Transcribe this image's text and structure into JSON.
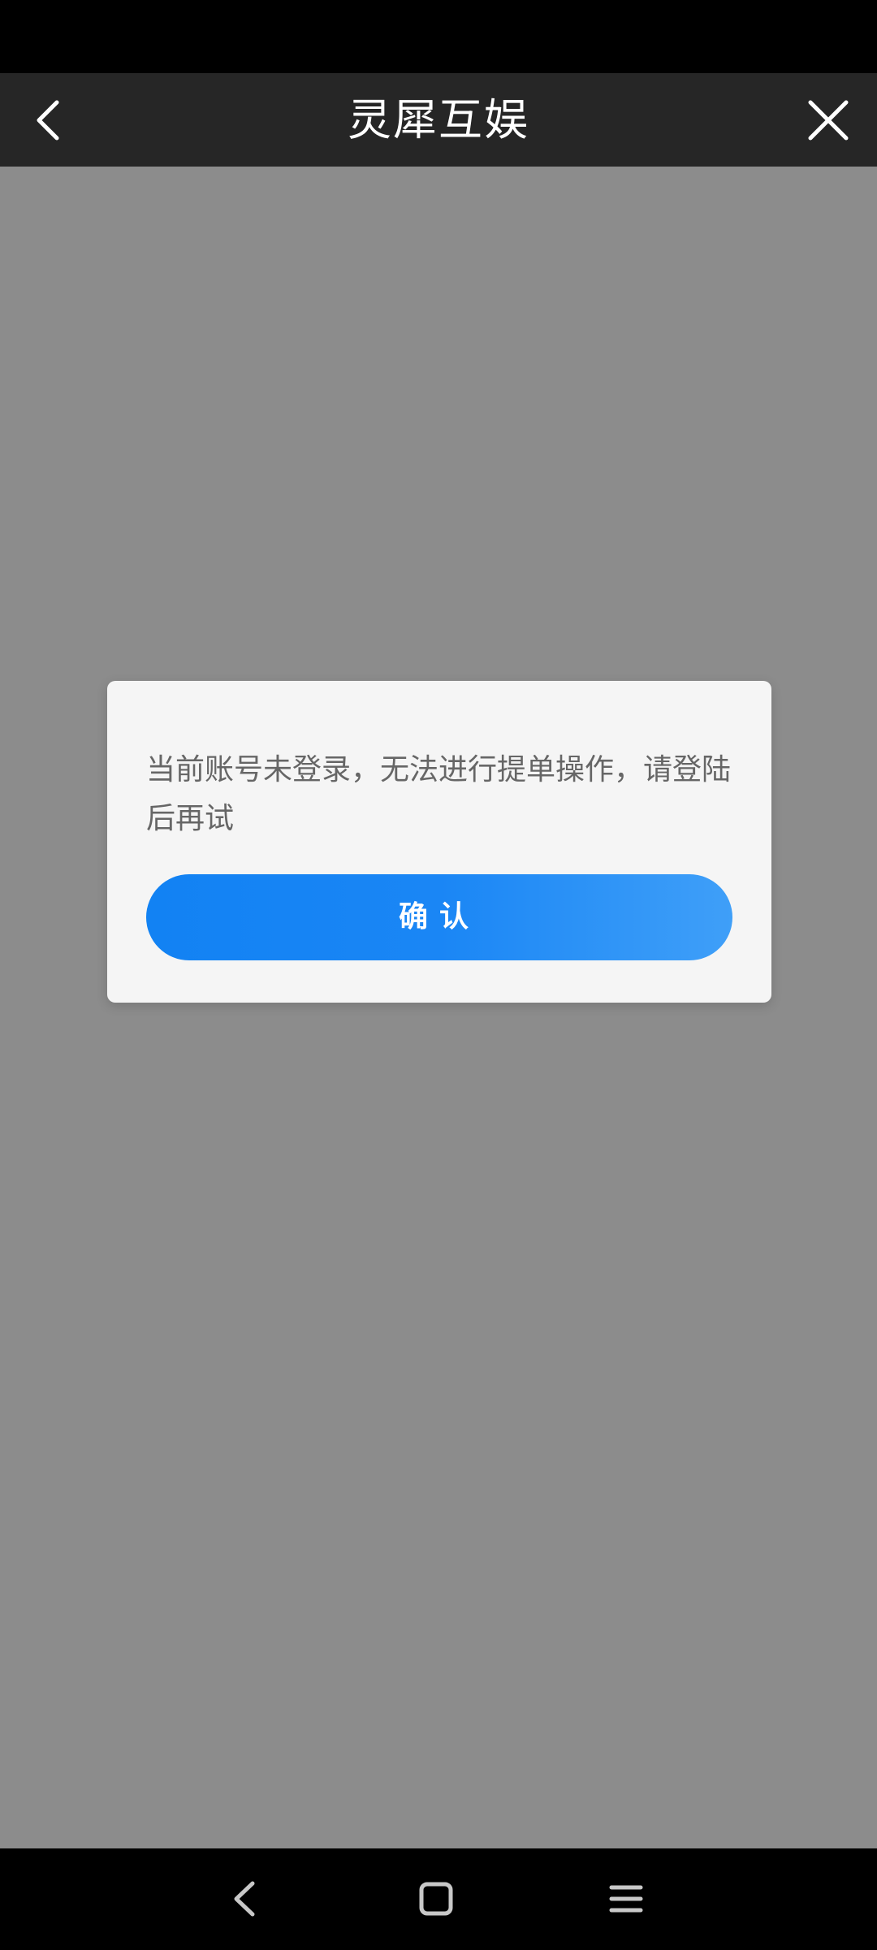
{
  "header": {
    "title": "灵犀互娱",
    "back_icon": "chevron-left-icon",
    "close_icon": "close-icon"
  },
  "dialog": {
    "message": "当前账号未登录，无法进行提单操作，请登陆后再试",
    "confirm_label": "确认"
  },
  "navbar": {
    "back_icon": "triangle-back-icon",
    "home_icon": "square-home-icon",
    "menu_icon": "hamburger-menu-icon"
  },
  "colors": {
    "header_bg": "#262626",
    "overlay_bg": "#8c8c8c",
    "dialog_bg": "#f5f5f5",
    "accent": "#1282f3",
    "message_text": "#666666"
  }
}
